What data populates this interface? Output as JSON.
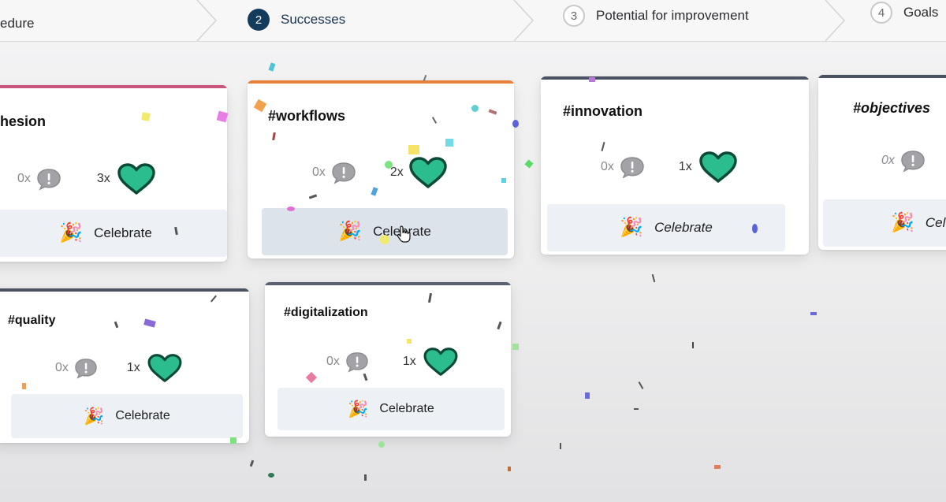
{
  "steps": [
    {
      "number": "",
      "label": "edure"
    },
    {
      "number": "2",
      "label": "Successes"
    },
    {
      "number": "3",
      "label": "Potential for improvement"
    },
    {
      "number": "4",
      "label": "Goals"
    }
  ],
  "cards": [
    {
      "title": "hesion",
      "comments": "0x",
      "hearts": "3x",
      "button": "Celebrate",
      "accent": "#c9557a"
    },
    {
      "title": "#workflows",
      "comments": "0x",
      "hearts": "2x",
      "button": "Celebrate",
      "accent": "#e8823a"
    },
    {
      "title": "#innovation",
      "comments": "0x",
      "hearts": "1x",
      "button": "Celebrate",
      "accent": "#4a5160"
    },
    {
      "title": "#objectives",
      "comments": "0x",
      "hearts": "",
      "button": "Cele",
      "accent": "#4a5160"
    },
    {
      "title": "#quality",
      "comments": "0x",
      "hearts": "1x",
      "button": "Celebrate",
      "accent": "#4a5160"
    },
    {
      "title": "#digitalization",
      "comments": "0x",
      "hearts": "1x",
      "button": "Celebrate",
      "accent": "#5a6170"
    }
  ],
  "colors": {
    "heart": "#2bbd8e",
    "heart_outline": "#0b4a36",
    "comment": "#9b9b9f",
    "nav_active": "#123b5c"
  },
  "icons": {
    "comment": "speech-bubble-exclamation-icon",
    "heart": "heart-icon",
    "celebrate": "party-popper-icon"
  }
}
